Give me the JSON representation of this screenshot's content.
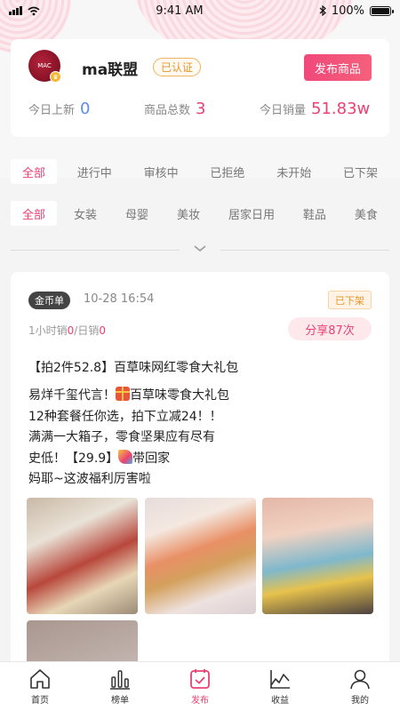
{
  "status_bar": {
    "time": "9:41 AM",
    "battery": "100%"
  },
  "header": {
    "avatar_text": "MAC",
    "shop_name": "ma联盟",
    "verified_label": "已认证",
    "publish_label": "发布商品",
    "stats": [
      {
        "label": "今日上新",
        "value": "0",
        "color": "#5b8ee6"
      },
      {
        "label": "商品总数",
        "value": "3",
        "color": "#e94273"
      },
      {
        "label": "今日销量",
        "value": "51.83w",
        "color": "#e94273"
      }
    ]
  },
  "status_tabs": [
    "全部",
    "进行中",
    "审核中",
    "已拒绝",
    "未开始",
    "已下架"
  ],
  "category_tabs": [
    "全部",
    "女装",
    "母婴",
    "美妆",
    "居家日用",
    "鞋品",
    "美食"
  ],
  "post": {
    "tag": "金币单",
    "time": "10-28 16:54",
    "status_badge": "已下架",
    "sales_hour_label": "1小时销",
    "sales_hour_value": "0",
    "sales_sep": "/日销",
    "sales_day_value": "0",
    "share_label": "分享87次",
    "title": "【拍2件52.8】百草味网红零食大礼包",
    "body": {
      "line1a": "易烊千玺代言！",
      "line1b": "百草味零食大礼包",
      "line2": "12种套餐任你选，拍下立减24！！",
      "line3": "满满一大箱子，零食坚果应有尽有",
      "line4a": "史低！【29.9】",
      "line4b": "带回家",
      "line5": "妈耶~这波福利厉害啦"
    }
  },
  "bottom_nav": [
    {
      "label": "首页",
      "icon": "home-icon"
    },
    {
      "label": "榜单",
      "icon": "chart-bars-icon"
    },
    {
      "label": "发布",
      "icon": "publish-icon"
    },
    {
      "label": "收益",
      "icon": "earnings-icon"
    },
    {
      "label": "我的",
      "icon": "user-icon"
    }
  ],
  "colors": {
    "accent": "#e94273",
    "blue": "#5b8ee6",
    "orange": "#e8962c"
  }
}
